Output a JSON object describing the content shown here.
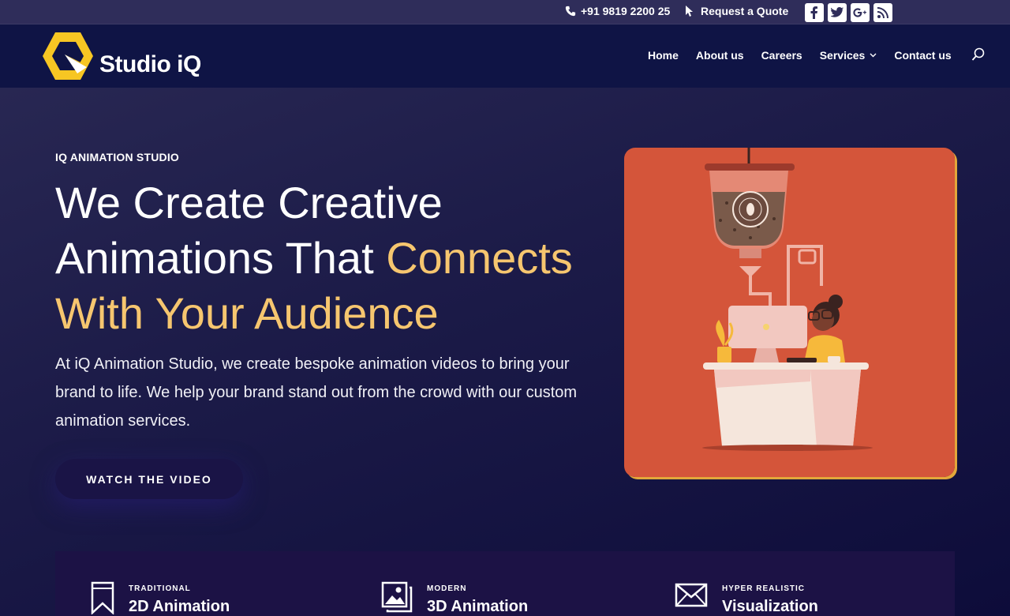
{
  "topbar": {
    "phone": "+91 9819 2200 25",
    "quote": "Request a Quote",
    "social": [
      "facebook-icon",
      "twitter-icon",
      "google-plus-icon",
      "rss-icon"
    ]
  },
  "header": {
    "logo_text": "Studio iQ",
    "nav": [
      {
        "label": "Home"
      },
      {
        "label": "About us"
      },
      {
        "label": "Careers"
      },
      {
        "label": "Services"
      },
      {
        "label": "Contact us"
      }
    ]
  },
  "hero": {
    "eyebrow": "IQ ANIMATION STUDIO",
    "headline_1": "We Create Creative",
    "headline_2": "Animations That ",
    "headline_accent_1": "Connects",
    "headline_accent_2": "With Your Audience",
    "description": "At iQ Animation Studio, we create bespoke animation videos to bring your brand to life. We help your brand stand out from the crowd with our custom animation services.",
    "cta": "WATCH THE VIDEO"
  },
  "services": [
    {
      "kicker": "TRADITIONAL",
      "title": "2D Animation",
      "icon": "bookmark-icon"
    },
    {
      "kicker": "MODERN",
      "title": "3D Animation",
      "icon": "images-icon"
    },
    {
      "kicker": "HYPER REALISTIC",
      "title": "Visualization",
      "icon": "envelope-icon"
    }
  ],
  "colors": {
    "accent": "#f6c66f",
    "illustration_bg": "#d4553a",
    "header_bg": "#0f1445"
  }
}
